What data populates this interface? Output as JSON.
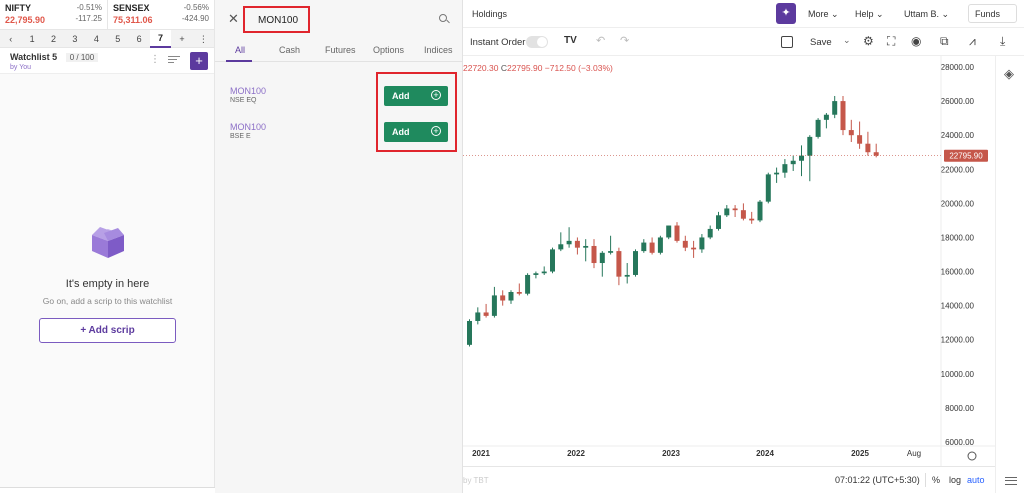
{
  "indices": [
    {
      "name": "NIFTY",
      "value": "22,795.90",
      "pct": "-0.51%",
      "change": "-117.25"
    },
    {
      "name": "SENSEX",
      "value": "75,311.06",
      "pct": "-0.56%",
      "change": "-424.90"
    }
  ],
  "watchlist_tabs": [
    "‹",
    "1",
    "2",
    "3",
    "4",
    "5",
    "6",
    "7",
    "+",
    "⋮"
  ],
  "watchlist": {
    "title": "Watchlist 5",
    "count": "0 / 100",
    "by": "by You",
    "empty_title": "It's empty in here",
    "empty_sub": "Go on, add a scrip to this watchlist",
    "add_scrip": "+ Add scrip"
  },
  "search": {
    "query": "MON100",
    "close": "✕",
    "tabs": [
      "All",
      "Cash",
      "Futures",
      "Options",
      "Indices"
    ],
    "results": [
      {
        "symbol": "MON100",
        "exchange": "NSE EQ",
        "button": "Add"
      },
      {
        "symbol": "MON100",
        "exchange": "BSE E",
        "button": "Add"
      }
    ]
  },
  "nav": {
    "holdings": "Holdings",
    "more": "More ⌄",
    "help": "Help ⌄",
    "user": "Uttam B. ⌄",
    "funds": "Funds"
  },
  "toolbar": {
    "instant_order": "Instant Order",
    "save": "Save"
  },
  "legend": {
    "high": "22720.30",
    "close_label": "C",
    "close": "22795.90",
    "change": "−712.50 (−3.03%)"
  },
  "bottom": {
    "watermark": "by TBT",
    "time": "07:01:22 (UTC+5:30)",
    "percent": "%",
    "log": "log",
    "auto": "auto"
  },
  "colors": {
    "up": "#26775b",
    "down": "#c5574a",
    "accent": "#5c3a9e",
    "add_button": "#1f8a5e",
    "highlight_box": "#e0252d"
  },
  "chart_data": {
    "type": "candlestick",
    "current_price": "22795.90",
    "y_ticks": [
      6000,
      8000,
      10000,
      12000,
      14000,
      16000,
      18000,
      20000,
      22000,
      24000,
      26000,
      28000
    ],
    "y_range": [
      6000,
      28000
    ],
    "x_ticks": [
      "2021",
      "2022",
      "2023",
      "2024",
      "2025",
      "Aug"
    ],
    "candles": [
      {
        "o": 11700,
        "h": 13200,
        "l": 11600,
        "c": 13100
      },
      {
        "o": 13100,
        "h": 13900,
        "l": 12900,
        "c": 13600
      },
      {
        "o": 13600,
        "h": 14100,
        "l": 13300,
        "c": 13400
      },
      {
        "o": 13400,
        "h": 15100,
        "l": 13300,
        "c": 14600
      },
      {
        "o": 14600,
        "h": 14900,
        "l": 14000,
        "c": 14300
      },
      {
        "o": 14300,
        "h": 14900,
        "l": 14100,
        "c": 14800
      },
      {
        "o": 14800,
        "h": 15300,
        "l": 14600,
        "c": 14700
      },
      {
        "o": 14700,
        "h": 15900,
        "l": 14600,
        "c": 15800
      },
      {
        "o": 15800,
        "h": 16000,
        "l": 15600,
        "c": 15900
      },
      {
        "o": 15900,
        "h": 16300,
        "l": 15800,
        "c": 16000
      },
      {
        "o": 16000,
        "h": 17400,
        "l": 15900,
        "c": 17300
      },
      {
        "o": 17300,
        "h": 18300,
        "l": 17200,
        "c": 17600
      },
      {
        "o": 17600,
        "h": 18600,
        "l": 17400,
        "c": 17800
      },
      {
        "o": 17800,
        "h": 18000,
        "l": 17000,
        "c": 17400
      },
      {
        "o": 17400,
        "h": 17900,
        "l": 16600,
        "c": 17500
      },
      {
        "o": 17500,
        "h": 17900,
        "l": 16200,
        "c": 16500
      },
      {
        "o": 16500,
        "h": 17200,
        "l": 15700,
        "c": 17100
      },
      {
        "o": 17100,
        "h": 18100,
        "l": 17000,
        "c": 17200
      },
      {
        "o": 17200,
        "h": 17400,
        "l": 15200,
        "c": 15700
      },
      {
        "o": 15700,
        "h": 16500,
        "l": 15300,
        "c": 15800
      },
      {
        "o": 15800,
        "h": 17300,
        "l": 15700,
        "c": 17200
      },
      {
        "o": 17200,
        "h": 17900,
        "l": 17100,
        "c": 17700
      },
      {
        "o": 17700,
        "h": 18000,
        "l": 17000,
        "c": 17100
      },
      {
        "o": 17100,
        "h": 18100,
        "l": 17000,
        "c": 18000
      },
      {
        "o": 18000,
        "h": 18700,
        "l": 17900,
        "c": 18700
      },
      {
        "o": 18700,
        "h": 18900,
        "l": 17700,
        "c": 17800
      },
      {
        "o": 17800,
        "h": 18100,
        "l": 17200,
        "c": 17400
      },
      {
        "o": 17400,
        "h": 17800,
        "l": 16800,
        "c": 17300
      },
      {
        "o": 17300,
        "h": 18200,
        "l": 17100,
        "c": 18000
      },
      {
        "o": 18000,
        "h": 18700,
        "l": 17900,
        "c": 18500
      },
      {
        "o": 18500,
        "h": 19500,
        "l": 18400,
        "c": 19300
      },
      {
        "o": 19300,
        "h": 19900,
        "l": 19200,
        "c": 19700
      },
      {
        "o": 19700,
        "h": 19900,
        "l": 19200,
        "c": 19600
      },
      {
        "o": 19600,
        "h": 20000,
        "l": 19000,
        "c": 19100
      },
      {
        "o": 19100,
        "h": 19500,
        "l": 18800,
        "c": 19000
      },
      {
        "o": 19000,
        "h": 20200,
        "l": 18900,
        "c": 20100
      },
      {
        "o": 20100,
        "h": 21800,
        "l": 20000,
        "c": 21700
      },
      {
        "o": 21700,
        "h": 22100,
        "l": 21200,
        "c": 21800
      },
      {
        "o": 21800,
        "h": 22600,
        "l": 21500,
        "c": 22300
      },
      {
        "o": 22300,
        "h": 22800,
        "l": 21900,
        "c": 22500
      },
      {
        "o": 22500,
        "h": 23400,
        "l": 21600,
        "c": 22800
      },
      {
        "o": 22800,
        "h": 24000,
        "l": 21300,
        "c": 23900
      },
      {
        "o": 23900,
        "h": 25000,
        "l": 23800,
        "c": 24900
      },
      {
        "o": 24900,
        "h": 25300,
        "l": 24400,
        "c": 25200
      },
      {
        "o": 25200,
        "h": 26300,
        "l": 25000,
        "c": 26000
      },
      {
        "o": 26000,
        "h": 26300,
        "l": 24000,
        "c": 24300
      },
      {
        "o": 24300,
        "h": 24900,
        "l": 23600,
        "c": 24000
      },
      {
        "o": 24000,
        "h": 24800,
        "l": 23200,
        "c": 23500
      },
      {
        "o": 23500,
        "h": 24200,
        "l": 22800,
        "c": 23000
      },
      {
        "o": 23000,
        "h": 23500,
        "l": 22700,
        "c": 22800
      }
    ]
  }
}
